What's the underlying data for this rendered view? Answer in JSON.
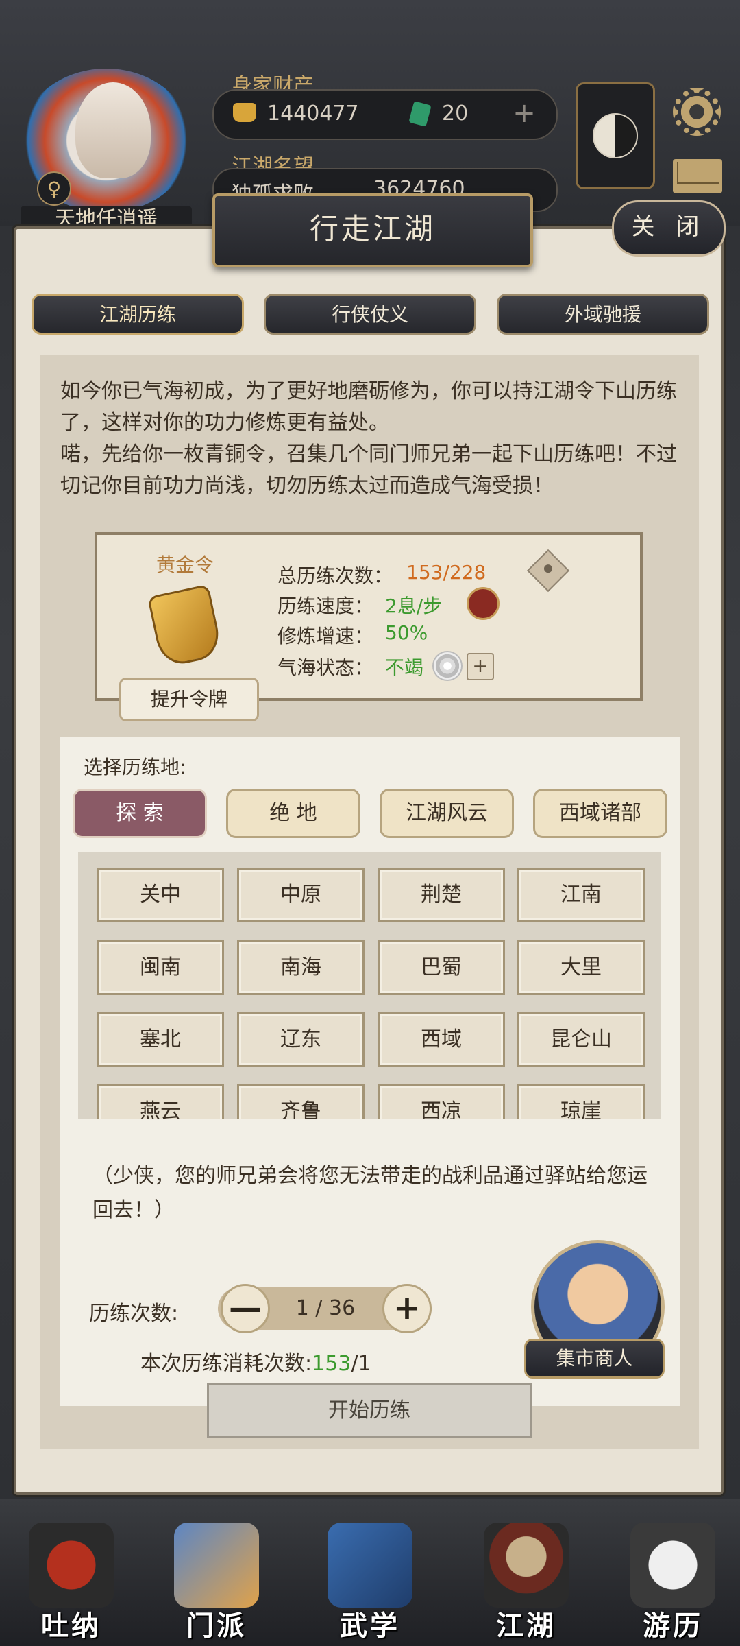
{
  "hud": {
    "wealth_label": "身家财产",
    "coins": "1440477",
    "jade": "20",
    "plus": "+",
    "reputation_label": "江湖名望",
    "reputation_title": "独孤求败",
    "reputation_value": "3624760",
    "player_name": "天地任逍遥",
    "gender_symbol": "♀"
  },
  "dialog": {
    "title": "行走江湖",
    "close_label": "关 闭",
    "tabs": [
      {
        "label": "江湖历练",
        "active": true
      },
      {
        "label": "行侠仗义",
        "active": false
      },
      {
        "label": "外域驰援",
        "active": false
      }
    ],
    "intro_p1": "如今你已气海初成，为了更好地磨砺修为，你可以持江湖令下山历练了，这样对你的功力修炼更有益处。",
    "intro_p2": "喏，先给你一枚青铜令，召集几个同门师兄弟一起下山历练吧！不过切记你目前功力尚浅，切勿历练太过而造成气海受损！",
    "token": {
      "name": "黄金令",
      "upgrade_label": "提升令牌",
      "stats": [
        {
          "label": "总历练次数：",
          "value": "153/228",
          "color": "#d06a1e"
        },
        {
          "label": "历练速度：",
          "value": "2息/步",
          "color": "#3c9a2e"
        },
        {
          "label": "修炼增速：",
          "value": "50%",
          "color": "#3c9a2e"
        },
        {
          "label": "气海状态：",
          "value": "不竭",
          "color": "#3c9a2e"
        }
      ],
      "plus": "+"
    },
    "select_label": "选择历练地:",
    "categories": [
      {
        "label": "探 索",
        "active": true
      },
      {
        "label": "绝 地",
        "active": false
      },
      {
        "label": "江湖风云",
        "active": false
      },
      {
        "label": "西域诸部",
        "active": false
      }
    ],
    "locations": [
      "关中",
      "中原",
      "荆楚",
      "江南",
      "闽南",
      "南海",
      "巴蜀",
      "大里",
      "塞北",
      "辽东",
      "西域",
      "昆仑山",
      "燕云",
      "齐鲁",
      "西凉",
      "琼崖"
    ],
    "note": "（少侠，您的师兄弟会将您无法带走的战利品通过驿站给您运回去！）",
    "count_label": "历练次数:",
    "minus": "—",
    "plus_step": "+",
    "count_value": "1 / 36",
    "cost_label": "本次历练消耗次数:",
    "cost_value": "153",
    "cost_suffix": "/1",
    "merchant_label": "集市商人",
    "start_label": "开始历练"
  },
  "nav": [
    {
      "label": "吐纳",
      "icon": "gourd-icon"
    },
    {
      "label": "门派",
      "icon": "sect-icon"
    },
    {
      "label": "武学",
      "icon": "book-icon"
    },
    {
      "label": "江湖",
      "icon": "hat-icon"
    },
    {
      "label": "游历",
      "icon": "horse-icon"
    }
  ],
  "colors": {
    "accent_orange": "#d06a1e",
    "accent_green": "#3c9a2e",
    "active_category": "#8a5a66"
  }
}
